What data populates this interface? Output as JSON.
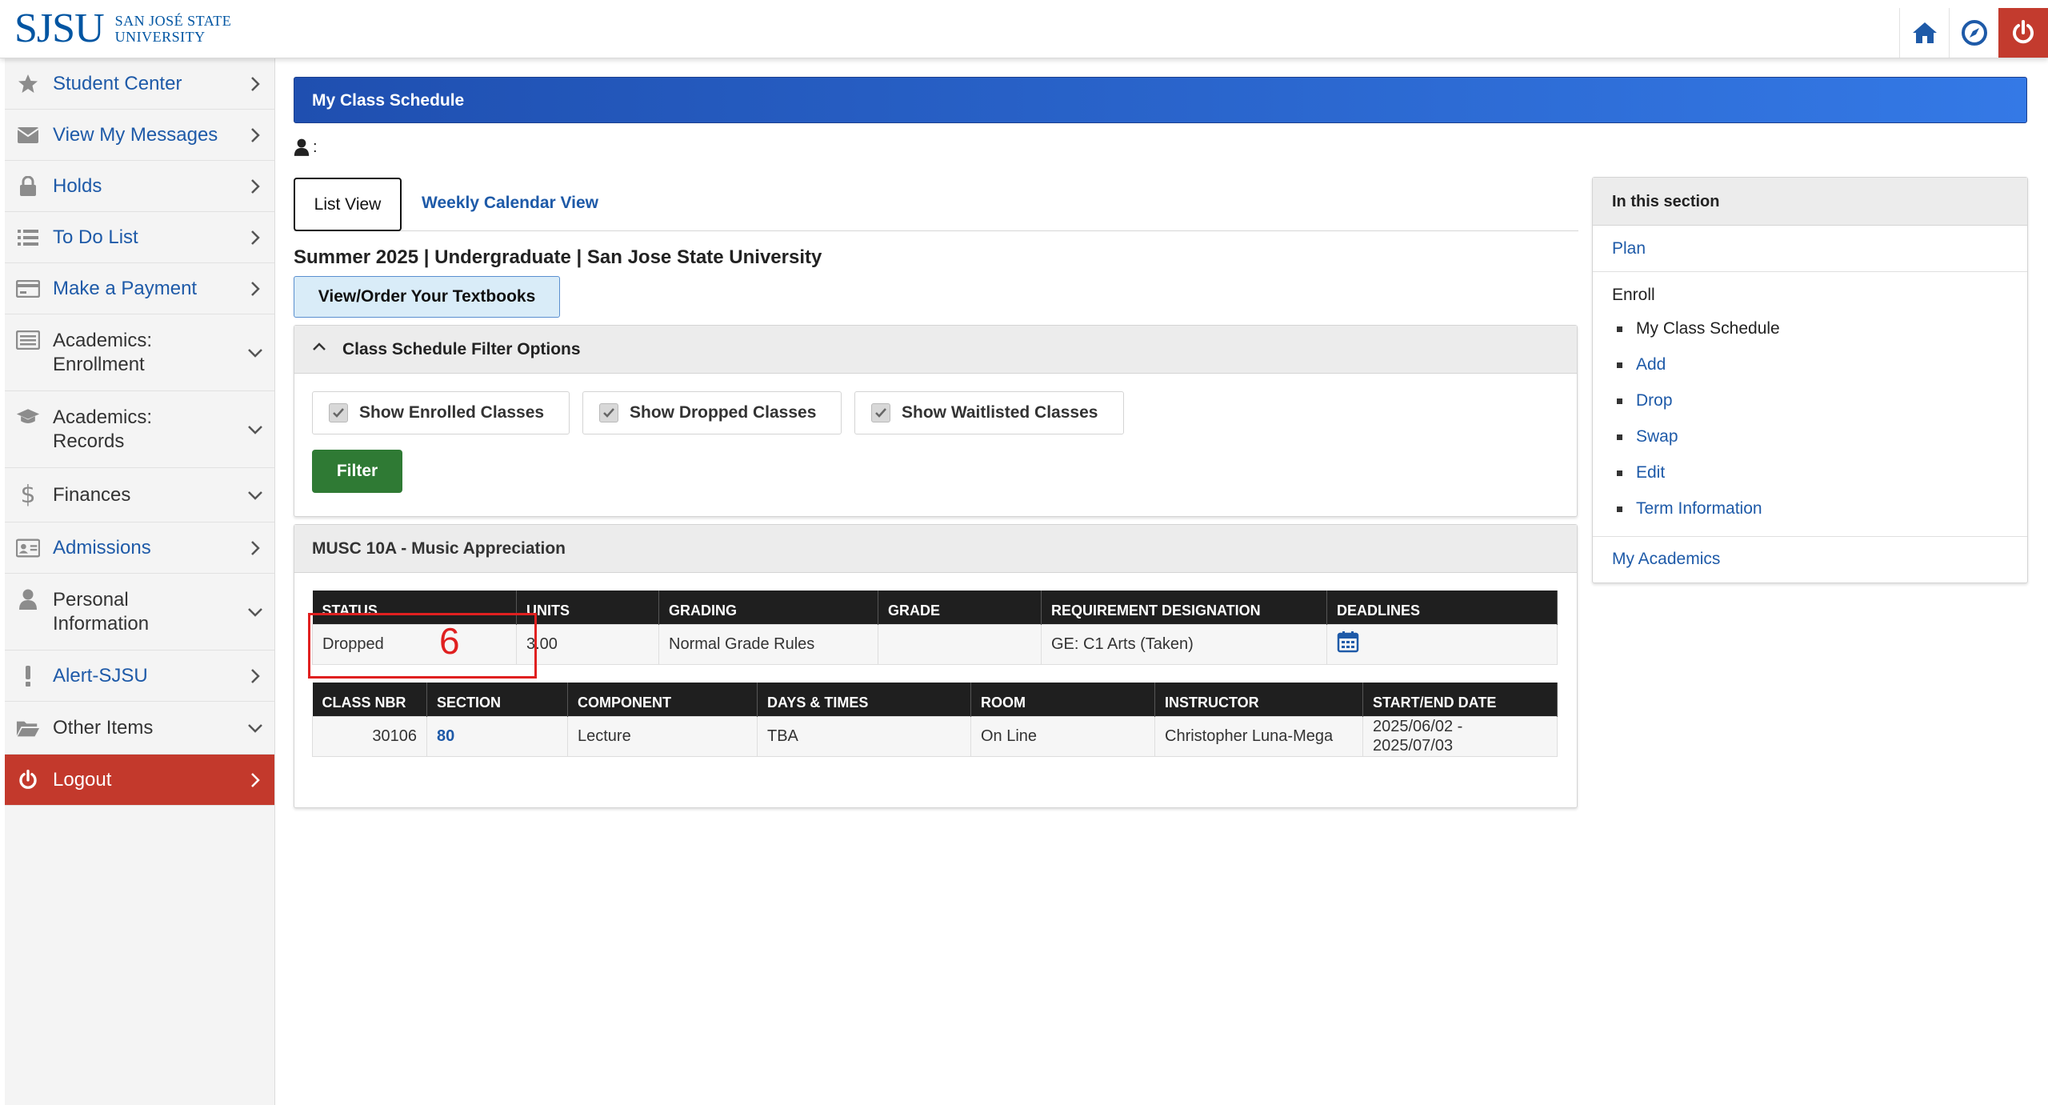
{
  "header": {
    "logo_mark": "SJSU",
    "logo_line1": "SAN JOSÉ STATE",
    "logo_line2": "UNIVERSITY",
    "icons": [
      "home-icon",
      "compass-icon",
      "power-icon"
    ]
  },
  "sidebar": {
    "items": [
      {
        "label": "Student Center",
        "icon": "star-icon",
        "chevron": "right"
      },
      {
        "label": "View My Messages",
        "icon": "envelope-icon",
        "chevron": "right"
      },
      {
        "label": "Holds",
        "icon": "lock-icon",
        "chevron": "right"
      },
      {
        "label": "To Do List",
        "icon": "list-icon",
        "chevron": "right"
      },
      {
        "label": "Make a Payment",
        "icon": "credit-card-icon",
        "chevron": "right"
      },
      {
        "label": "Academics: Enrollment",
        "line1": "Academics:",
        "line2": "Enrollment",
        "icon": "enrollment-icon",
        "chevron": "down"
      },
      {
        "label": "Academics: Records",
        "line1": "Academics:",
        "line2": "Records",
        "icon": "graduation-cap-icon",
        "chevron": "down"
      },
      {
        "label": "Finances",
        "icon": "dollar-icon",
        "chevron": "down"
      },
      {
        "label": "Admissions",
        "icon": "id-card-icon",
        "chevron": "right"
      },
      {
        "label": "Personal Information",
        "line1": "Personal",
        "line2": "Information",
        "icon": "person-icon",
        "chevron": "down"
      },
      {
        "label": "Alert-SJSU",
        "icon": "exclamation-icon",
        "chevron": "right"
      },
      {
        "label": "Other Items",
        "icon": "folder-icon",
        "chevron": "down"
      },
      {
        "label": "Logout",
        "icon": "power-icon",
        "chevron": "right"
      }
    ]
  },
  "main": {
    "banner_title": "My Class Schedule",
    "person_suffix": ":",
    "tabs": {
      "list_view": "List View",
      "calendar_view": "Weekly Calendar View"
    },
    "term_title": "Summer 2025 | Undergraduate | San Jose State University",
    "textbook_button": "View/Order Your Textbooks",
    "filter": {
      "title": "Class Schedule Filter Options",
      "enrolled": "Show Enrolled Classes",
      "dropped": "Show Dropped Classes",
      "waitlisted": "Show Waitlisted Classes",
      "button": "Filter"
    },
    "course": {
      "title": "MUSC 10A - Music Appreciation",
      "summary_headers": [
        "STATUS",
        "UNITS",
        "GRADING",
        "GRADE",
        "REQUIREMENT DESIGNATION",
        "DEADLINES"
      ],
      "summary_row": {
        "status": "Dropped",
        "units": "3.00",
        "grading": "Normal Grade Rules",
        "grade": "",
        "requirement": "GE: C1 Arts (Taken)"
      },
      "detail_headers": [
        "CLASS NBR",
        "SECTION",
        "COMPONENT",
        "DAYS & TIMES",
        "ROOM",
        "INSTRUCTOR",
        "START/END DATE"
      ],
      "detail_row": {
        "class_nbr": "30106",
        "section": "80",
        "component": "Lecture",
        "days_times": "TBA",
        "room": "On Line",
        "instructor": "Christopher Luna-Mega",
        "start_date": "2025/06/02 -",
        "end_date": "2025/07/03"
      }
    },
    "annotation": {
      "label": "6",
      "color": "#e02020"
    }
  },
  "section_panel": {
    "title": "In this section",
    "plan": "Plan",
    "enroll": "Enroll",
    "enroll_items": [
      "My Class Schedule",
      "Add",
      "Drop",
      "Swap",
      "Edit",
      "Term Information"
    ],
    "my_academics": "My Academics"
  },
  "colors": {
    "brand_blue": "#0055a2",
    "link_blue": "#1e5aa8",
    "banner_start": "#1f4fb0",
    "banner_end": "#3479e6",
    "logout_red": "#c3392c",
    "filter_green": "#2f7a34"
  }
}
